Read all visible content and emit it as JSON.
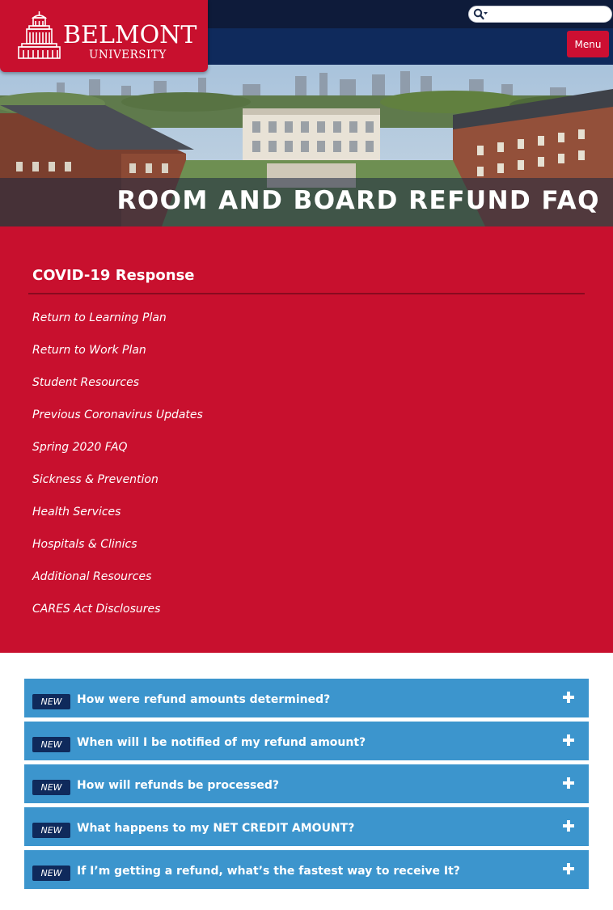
{
  "header": {
    "logo_word": "BELMONT",
    "logo_sub": "UNIVERSITY",
    "search_placeholder": "",
    "menu_label": "Menu"
  },
  "hero": {
    "title": "ROOM AND BOARD REFUND FAQ"
  },
  "covid": {
    "heading": "COVID-19 Response",
    "links": [
      "Return to Learning Plan",
      "Return to Work Plan",
      "Student Resources",
      "Previous Coronavirus Updates",
      "Spring 2020 FAQ",
      "Sickness & Prevention",
      "Health Services",
      "Hospitals & Clinics",
      "Additional Resources",
      "CARES Act Disclosures"
    ]
  },
  "faq": {
    "badge": "NEW",
    "questions": [
      "How were refund amounts determined?",
      "When will I be notified of my refund amount?",
      "How will refunds be processed?",
      "What happens to my NET CREDIT AMOUNT?",
      "If I’m getting a refund, what’s the fastest way to receive It?"
    ]
  },
  "colors": {
    "brand_red": "#c8102e",
    "navy": "#0f2a5c",
    "accordion_blue": "#3c95cd"
  },
  "icons": [
    "search-icon",
    "belmont-tower-logo",
    "plus-icon"
  ]
}
